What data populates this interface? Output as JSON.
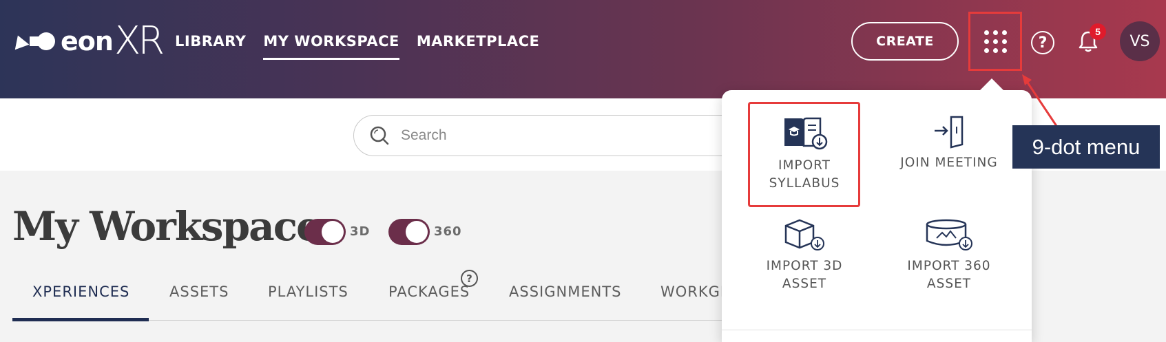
{
  "header": {
    "logo_left": "eon",
    "logo_right": "XR",
    "nav": [
      "LIBRARY",
      "MY WORKSPACE",
      "MARKETPLACE"
    ],
    "active_nav": "MY WORKSPACE",
    "create_label": "CREATE",
    "notification_count": "5",
    "avatar_initials": "VS",
    "help_label": "?"
  },
  "search": {
    "placeholder": "Search",
    "value": ""
  },
  "workspace": {
    "title": "My Workspace",
    "toggles": [
      {
        "label": "3D",
        "on": true
      },
      {
        "label": "360",
        "on": true
      }
    ],
    "tabs": [
      "XPERIENCES",
      "ASSETS",
      "PLAYLISTS",
      "PACKAGES",
      "ASSIGNMENTS",
      "WORKGR"
    ],
    "active_tab": "XPERIENCES",
    "packages_help": "?"
  },
  "menu": {
    "items": [
      {
        "line1": "IMPORT",
        "line2": "SYLLABUS",
        "icon": "import-syllabus-icon"
      },
      {
        "line1": "JOIN MEETING",
        "line2": "",
        "icon": "join-meeting-icon"
      },
      {
        "line1": "IMPORT 3D",
        "line2": "ASSET",
        "icon": "import-3d-icon"
      },
      {
        "line1": "IMPORT 360",
        "line2": "ASSET",
        "icon": "import-360-icon"
      }
    ]
  },
  "annotation": {
    "callout": "9-dot menu"
  },
  "colors": {
    "navy": "#253457",
    "toggle": "#6b2e4a",
    "highlight": "#e63b3b",
    "badge": "#e01b2b"
  }
}
